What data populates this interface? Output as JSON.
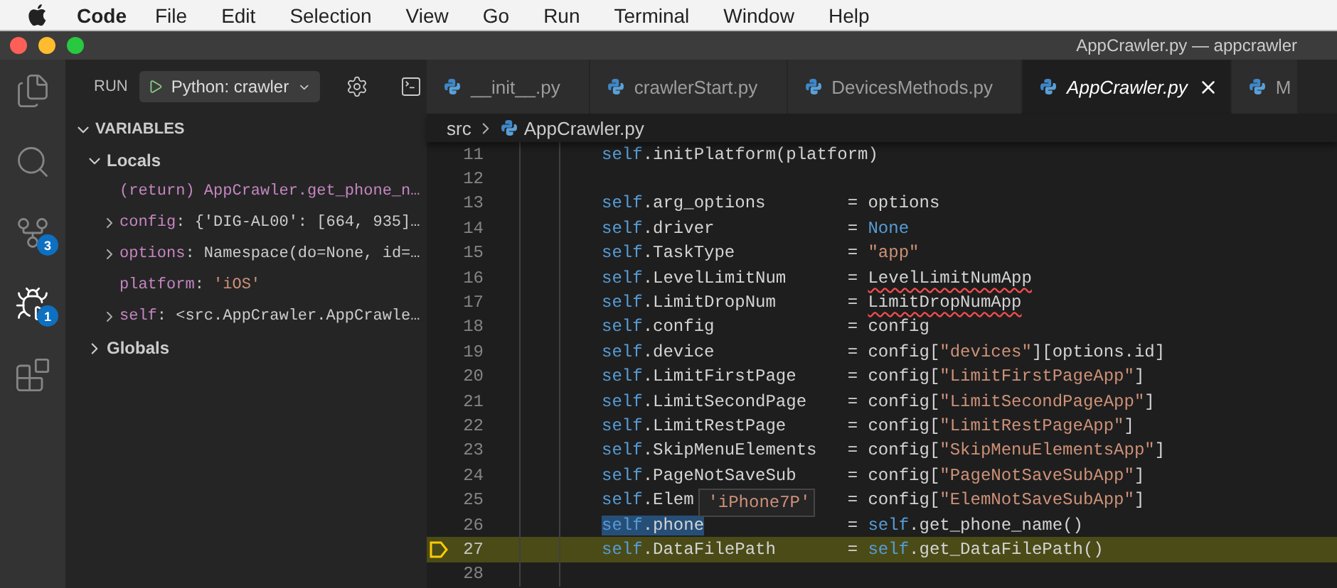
{
  "menu_bar": {
    "items": [
      {
        "label": "Code",
        "kind": "app"
      },
      {
        "label": "File",
        "kind": "menu"
      },
      {
        "label": "Edit",
        "kind": "menu"
      },
      {
        "label": "Selection",
        "kind": "menu"
      },
      {
        "label": "View",
        "kind": "menu"
      },
      {
        "label": "Go",
        "kind": "menu"
      },
      {
        "label": "Run",
        "kind": "menu"
      },
      {
        "label": "Terminal",
        "kind": "menu"
      },
      {
        "label": "Window",
        "kind": "menu"
      },
      {
        "label": "Help",
        "kind": "menu"
      }
    ]
  },
  "window": {
    "title": "AppCrawler.py — appcrawler"
  },
  "activity_bar": {
    "items": [
      {
        "kind": "explorer",
        "selected": false
      },
      {
        "kind": "search",
        "selected": false
      },
      {
        "kind": "source-control",
        "selected": false,
        "badge": "3"
      },
      {
        "kind": "run-debug",
        "selected": true,
        "badge": "1"
      },
      {
        "kind": "extensions",
        "selected": false
      }
    ]
  },
  "run_panel": {
    "label": "RUN",
    "configuration": "Python: crawler"
  },
  "variables": {
    "title": "VARIABLES",
    "expanded": true,
    "scopes": [
      {
        "name": "Locals",
        "expanded": true,
        "children": [
          {
            "expandable": false,
            "tokens": [
              {
                "text": "(return) AppCrawler.get_phone_n…",
                "kind": "name"
              }
            ]
          },
          {
            "expandable": true,
            "tokens": [
              {
                "text": "config",
                "kind": "name"
              },
              {
                "text": ": ",
                "kind": "plain"
              },
              {
                "text": "{'DIG-AL00': [664, 935]…",
                "kind": "plain"
              }
            ]
          },
          {
            "expandable": true,
            "tokens": [
              {
                "text": "options",
                "kind": "name"
              },
              {
                "text": ": ",
                "kind": "plain"
              },
              {
                "text": "Namespace(do=None, id=…",
                "kind": "plain"
              }
            ]
          },
          {
            "expandable": false,
            "tokens": [
              {
                "text": "platform",
                "kind": "name"
              },
              {
                "text": ": ",
                "kind": "plain"
              },
              {
                "text": "'iOS'",
                "kind": "string"
              }
            ]
          },
          {
            "expandable": true,
            "tokens": [
              {
                "text": "self",
                "kind": "name"
              },
              {
                "text": ": ",
                "kind": "plain"
              },
              {
                "text": "<src.AppCrawler.AppCrawle…",
                "kind": "plain"
              }
            ]
          }
        ]
      },
      {
        "name": "Globals",
        "expanded": false
      }
    ]
  },
  "tabs": [
    {
      "label": "__init__.py",
      "selected": false
    },
    {
      "label": "crawlerStart.py",
      "selected": false
    },
    {
      "label": "DevicesMethods.py",
      "selected": false
    },
    {
      "label": "AppCrawler.py",
      "selected": true
    },
    {
      "label": "M",
      "selected": false
    }
  ],
  "breadcrumb": [
    "src",
    "AppCrawler.py"
  ],
  "code_lines": [
    {
      "number": "11",
      "target": [
        {
          "text": "self",
          "kind": "self"
        },
        {
          "text": ".initPlatform(platform)",
          "kind": "plain"
        }
      ]
    },
    {
      "number": "12"
    },
    {
      "number": "13",
      "target": [
        {
          "text": "self",
          "kind": "self"
        },
        {
          "text": ".arg_options",
          "kind": "plain"
        }
      ],
      "value": [
        {
          "text": "= options",
          "kind": "plain"
        }
      ]
    },
    {
      "number": "14",
      "target": [
        {
          "text": "self",
          "kind": "self"
        },
        {
          "text": ".driver",
          "kind": "plain"
        }
      ],
      "value": [
        {
          "text": "= ",
          "kind": "plain"
        },
        {
          "text": "None",
          "kind": "constant"
        }
      ]
    },
    {
      "number": "15",
      "target": [
        {
          "text": "self",
          "kind": "self"
        },
        {
          "text": ".TaskType",
          "kind": "plain"
        }
      ],
      "value": [
        {
          "text": "= ",
          "kind": "plain"
        },
        {
          "text": "\"app\"",
          "kind": "string"
        }
      ]
    },
    {
      "number": "16",
      "target": [
        {
          "text": "self",
          "kind": "self"
        },
        {
          "text": ".LevelLimitNum",
          "kind": "plain"
        }
      ],
      "value": [
        {
          "text": "= ",
          "kind": "plain"
        },
        {
          "text": "LevelLimitNumApp",
          "kind": "error"
        }
      ]
    },
    {
      "number": "17",
      "target": [
        {
          "text": "self",
          "kind": "self"
        },
        {
          "text": ".LimitDropNum",
          "kind": "plain"
        }
      ],
      "value": [
        {
          "text": "= ",
          "kind": "plain"
        },
        {
          "text": "LimitDropNumApp",
          "kind": "error"
        }
      ]
    },
    {
      "number": "18",
      "target": [
        {
          "text": "self",
          "kind": "self"
        },
        {
          "text": ".config",
          "kind": "plain"
        }
      ],
      "value": [
        {
          "text": "= config",
          "kind": "plain"
        }
      ]
    },
    {
      "number": "19",
      "target": [
        {
          "text": "self",
          "kind": "self"
        },
        {
          "text": ".device",
          "kind": "plain"
        }
      ],
      "value": [
        {
          "text": "= config[",
          "kind": "plain"
        },
        {
          "text": "\"devices\"",
          "kind": "string"
        },
        {
          "text": "][options.id]",
          "kind": "plain"
        }
      ]
    },
    {
      "number": "20",
      "target": [
        {
          "text": "self",
          "kind": "self"
        },
        {
          "text": ".LimitFirstPage",
          "kind": "plain"
        }
      ],
      "value": [
        {
          "text": "= config[",
          "kind": "plain"
        },
        {
          "text": "\"LimitFirstPageApp\"",
          "kind": "string"
        },
        {
          "text": "]",
          "kind": "plain"
        }
      ]
    },
    {
      "number": "21",
      "target": [
        {
          "text": "self",
          "kind": "self"
        },
        {
          "text": ".LimitSecondPage",
          "kind": "plain"
        }
      ],
      "value": [
        {
          "text": "= config[",
          "kind": "plain"
        },
        {
          "text": "\"LimitSecondPageApp\"",
          "kind": "string"
        },
        {
          "text": "]",
          "kind": "plain"
        }
      ]
    },
    {
      "number": "22",
      "target": [
        {
          "text": "self",
          "kind": "self"
        },
        {
          "text": ".LimitRestPage",
          "kind": "plain"
        }
      ],
      "value": [
        {
          "text": "= config[",
          "kind": "plain"
        },
        {
          "text": "\"LimitRestPageApp\"",
          "kind": "string"
        },
        {
          "text": "]",
          "kind": "plain"
        }
      ]
    },
    {
      "number": "23",
      "target": [
        {
          "text": "self",
          "kind": "self"
        },
        {
          "text": ".SkipMenuElements",
          "kind": "plain"
        }
      ],
      "value": [
        {
          "text": "= config[",
          "kind": "plain"
        },
        {
          "text": "\"SkipMenuElementsApp\"",
          "kind": "string"
        },
        {
          "text": "]",
          "kind": "plain"
        }
      ]
    },
    {
      "number": "24",
      "target": [
        {
          "text": "self",
          "kind": "self"
        },
        {
          "text": ".PageNotSaveSub",
          "kind": "plain"
        }
      ],
      "value": [
        {
          "text": "= config[",
          "kind": "plain"
        },
        {
          "text": "\"PageNotSaveSubApp\"",
          "kind": "string"
        },
        {
          "text": "]",
          "kind": "plain"
        }
      ]
    },
    {
      "number": "25",
      "target": [
        {
          "text": "self",
          "kind": "self"
        },
        {
          "text": ".Elem",
          "kind": "plain"
        }
      ],
      "value": [
        {
          "text": "= config[",
          "kind": "plain"
        },
        {
          "text": "\"ElemNotSaveSubApp\"",
          "kind": "string"
        },
        {
          "text": "]",
          "kind": "plain"
        }
      ],
      "tooltip": "'iPhone7P'"
    },
    {
      "number": "26",
      "target": [
        {
          "text": "self",
          "kind": "self"
        },
        {
          "text": ".phone",
          "kind": "plain"
        }
      ],
      "value": [
        {
          "text": "= ",
          "kind": "plain"
        },
        {
          "text": "self",
          "kind": "self"
        },
        {
          "text": ".get_phone_name()",
          "kind": "plain"
        }
      ],
      "hovered": true
    },
    {
      "number": "27",
      "target": [
        {
          "text": "self",
          "kind": "self"
        },
        {
          "text": ".DataFilePath",
          "kind": "plain"
        }
      ],
      "value": [
        {
          "text": "= ",
          "kind": "plain"
        },
        {
          "text": "self",
          "kind": "self"
        },
        {
          "text": ".get_DataFilePath()",
          "kind": "plain"
        }
      ],
      "current": true
    },
    {
      "number": "28"
    }
  ]
}
